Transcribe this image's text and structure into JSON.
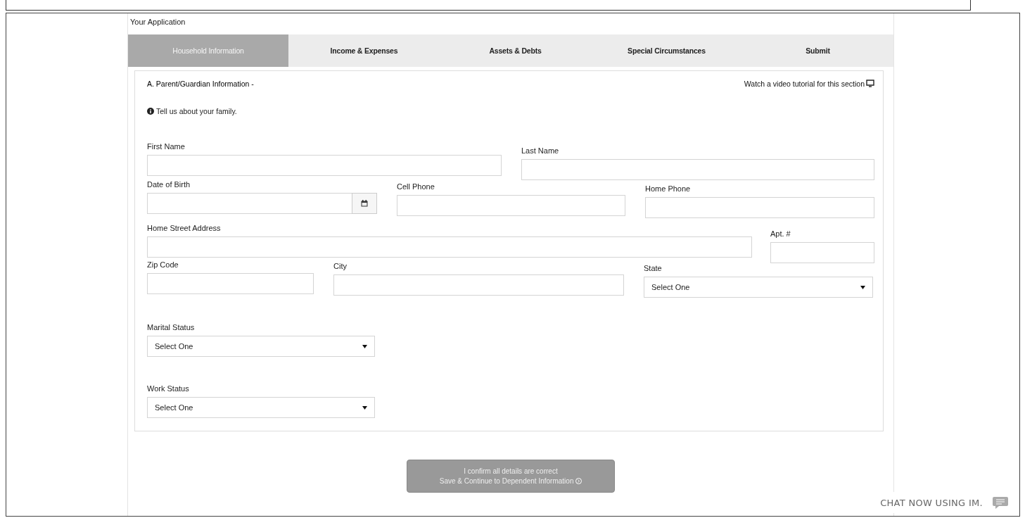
{
  "heading": "Your Application",
  "tabs": [
    {
      "label": "Household Information",
      "selected": true
    },
    {
      "label": "Income & Expenses",
      "selected": false
    },
    {
      "label": "Assets & Debts",
      "selected": false
    },
    {
      "label": "Special Circumstances",
      "selected": false
    },
    {
      "label": "Submit",
      "selected": false
    }
  ],
  "section": {
    "title": "A. Parent/Guardian Information -",
    "video_link": "Watch a video tutorial for this section",
    "hint": "Tell us about your family."
  },
  "rows": [
    [
      {
        "label": "First Name",
        "kind": "text"
      },
      {
        "label": "Last Name",
        "kind": "text"
      }
    ],
    [
      {
        "label": "Date of Birth",
        "kind": "date"
      },
      {
        "label": "Cell Phone",
        "kind": "text"
      },
      {
        "label": "Home Phone",
        "kind": "text"
      }
    ],
    [
      {
        "label": "Home Street Address",
        "kind": "text"
      },
      {
        "label": "Apt. #",
        "kind": "text"
      }
    ],
    [
      {
        "label": "Zip Code",
        "kind": "text"
      },
      {
        "label": "City",
        "kind": "text"
      },
      {
        "label": "State",
        "kind": "select",
        "value": "Select One"
      }
    ],
    [
      {
        "label": "Marital Status",
        "kind": "select",
        "value": "Select One"
      }
    ],
    [
      {
        "label": "Work Status",
        "kind": "select",
        "value": "Select One"
      }
    ]
  ],
  "continue_button": {
    "lines": [
      "I confirm all details are correct",
      "Save & Continue to Dependent Information"
    ]
  },
  "chat": {
    "label": "CHAT NOW USING IM."
  }
}
